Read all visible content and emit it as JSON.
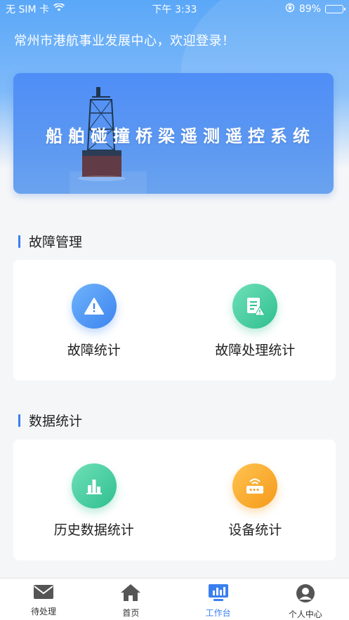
{
  "status_bar": {
    "carrier": "无 SIM 卡",
    "time": "下午 3:33",
    "battery": "89%",
    "battery_level": 0.89
  },
  "welcome_text": "常州市港航事业发展中心，欢迎登录！",
  "banner": {
    "title": "船舶碰撞桥梁遥测遥控系统"
  },
  "sections": [
    {
      "title": "故障管理",
      "items": [
        {
          "label": "故障统计",
          "icon": "warning-icon"
        },
        {
          "label": "故障处理统计",
          "icon": "document-warning-icon"
        }
      ]
    },
    {
      "title": "数据统计",
      "items": [
        {
          "label": "历史数据统计",
          "icon": "bar-chart-icon"
        },
        {
          "label": "设备统计",
          "icon": "router-icon"
        }
      ]
    }
  ],
  "tabs": [
    {
      "label": "待处理",
      "icon": "mail-icon"
    },
    {
      "label": "首页",
      "icon": "home-icon"
    },
    {
      "label": "工作台",
      "icon": "monitor-chart-icon",
      "active": true
    },
    {
      "label": "个人中心",
      "icon": "user-icon"
    }
  ],
  "colors": {
    "accent": "#3a7ff0",
    "header": "#5aa7f8",
    "green": "#2fbf90",
    "orange": "#f59a1a"
  }
}
